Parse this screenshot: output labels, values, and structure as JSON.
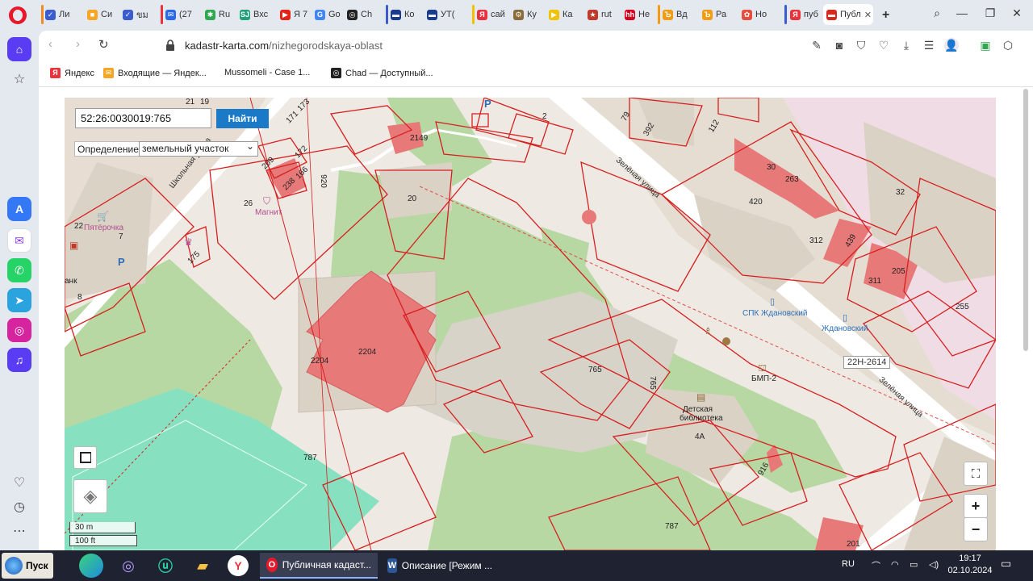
{
  "tabs": [
    {
      "label": "Ли",
      "color": "#3a5ccc",
      "fav_text": "✓"
    },
    {
      "label": "Си",
      "color": "#f5a623",
      "fav_text": "■"
    },
    {
      "label": "ขม",
      "color": "#3a5ccc",
      "fav_text": "✓"
    },
    {
      "label": "(27",
      "color": "#2a6ae6",
      "fav_text": "✉"
    },
    {
      "label": "Ru",
      "color": "#2fa84f",
      "fav_text": "✱"
    },
    {
      "label": "Вхс",
      "color": "#21a17a",
      "fav_text": "SJ"
    },
    {
      "label": "Я 7",
      "color": "#e62117",
      "fav_text": "▶"
    },
    {
      "label": "Go",
      "color": "#4285f4",
      "fav_text": "G"
    },
    {
      "label": "Ch",
      "color": "#222222",
      "fav_text": "◎"
    },
    {
      "label": "Ко",
      "color": "#1b3c8c",
      "fav_text": "▬"
    },
    {
      "label": "УТ(",
      "color": "#1b3c8c",
      "fav_text": "▬"
    },
    {
      "label": "сай",
      "color": "#e8323c",
      "fav_text": "Я"
    },
    {
      "label": "Ку",
      "color": "#8a6d3b",
      "fav_text": "⚙"
    },
    {
      "label": "Ка",
      "color": "#f2c200",
      "fav_text": "▶"
    },
    {
      "label": "rut",
      "color": "#c0392b",
      "fav_text": "★"
    },
    {
      "label": "Не",
      "color": "#d6001c",
      "fav_text": "hh"
    },
    {
      "label": "Вд",
      "color": "#f39c12",
      "fav_text": "Ъ"
    },
    {
      "label": "Ра",
      "color": "#f39c12",
      "fav_text": "Ъ"
    },
    {
      "label": "Но",
      "color": "#e74c3c",
      "fav_text": "✿"
    },
    {
      "label": "пуб",
      "color": "#e8323c",
      "fav_text": "Я"
    },
    {
      "label": "Публ",
      "color": "#d52b1e",
      "fav_text": "▬",
      "active": true
    }
  ],
  "address": {
    "domain": "kadastr-karta.com",
    "path": "/nizhegorodskaya-oblast"
  },
  "bookmarks": [
    {
      "label": "Яндекс",
      "color": "#e8323c",
      "fav_text": "Я"
    },
    {
      "label": "Входящие — Яндек...",
      "color": "#f5a623",
      "fav_text": "✉"
    },
    {
      "label": "Mussomeli - Case 1...",
      "color": "#ffffff",
      "fav_text": ""
    },
    {
      "label": "Chad — Доступный...",
      "color": "#222222",
      "fav_text": "◎"
    }
  ],
  "map": {
    "search_value": "52:26:0030019:765",
    "find_button": "Найти",
    "definition_label": "Определение:",
    "definition_value": "земельный участок",
    "scale_m": "30 m",
    "scale_ft": "100 ft",
    "zoom_in": "+",
    "zoom_out": "−",
    "labels": {
      "n21": "21",
      "n19": "19",
      "n173": "173",
      "n171": "171",
      "n172": "172",
      "n209": "209",
      "n166": "166",
      "n238": "238",
      "n920": "920",
      "n26": "26",
      "magnit": "Магнит",
      "n2149": "2149",
      "n20": "20",
      "n22": "22",
      "pyat": "Пятёрочка",
      "n7": "7",
      "n175": "175",
      "n8": "8",
      "bank": "анк",
      "shkolnaya": "Школьная улица",
      "zelenaya1": "Зелёная улица",
      "zelenaya2": "Зелёная улица",
      "n2": "2",
      "n79": "79",
      "n392": "392",
      "n112": "112",
      "n30": "30",
      "n263": "263",
      "n420": "420",
      "n32": "32",
      "n312": "312",
      "n439": "439",
      "n311": "311",
      "n205": "205",
      "n255": "255",
      "spk": "СПК Ждановский",
      "zhd": "Ждановский",
      "road": "22Н-2614",
      "bmp": "БМП-2",
      "n765a": "765",
      "n765b": "765",
      "det1": "Детская",
      "det2": "библиотека",
      "n4a": "4А",
      "n916": "916",
      "n2204a": "2204",
      "n2204b": "2204",
      "n2204c": "2204",
      "n787a": "787",
      "n787b": "787",
      "n201": "201"
    }
  },
  "taskbar": {
    "start": "Пуск",
    "tasks": [
      {
        "label": "Публичная кадаст...",
        "active": true
      },
      {
        "label": "Описание [Режим ...",
        "active": false
      }
    ],
    "lang": "RU",
    "time": "19:17",
    "date": "02.10.2024"
  }
}
